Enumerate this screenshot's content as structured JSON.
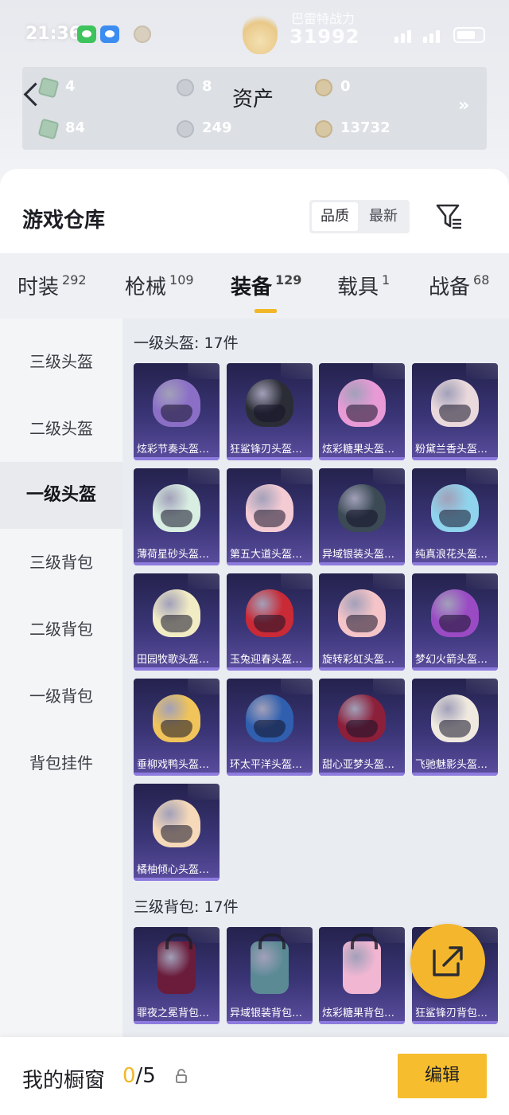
{
  "status_bar": {
    "time": "21:36",
    "battery": "41",
    "combat_power_label": "巴雷特战力",
    "combat_power_value": "31992"
  },
  "assets": {
    "title": "资产",
    "items": [
      {
        "value": "4",
        "icon": "silver-note-icon"
      },
      {
        "value": "8",
        "icon": "silver-coin-icon"
      },
      {
        "value": "0",
        "icon": "gold-coin-icon"
      },
      {
        "value": "84",
        "icon": "green-note-icon"
      },
      {
        "value": "249",
        "icon": "gray-coin-icon"
      },
      {
        "value": "13732",
        "icon": "bronze-coin-icon"
      }
    ],
    "more": "»"
  },
  "warehouse": {
    "title": "游戏仓库",
    "sort": {
      "quality": "品质",
      "latest": "最新"
    }
  },
  "tabs": [
    {
      "label": "时装",
      "count": "292"
    },
    {
      "label": "枪械",
      "count": "109"
    },
    {
      "label": "装备",
      "count": "129"
    },
    {
      "label": "载具",
      "count": "1"
    },
    {
      "label": "战备",
      "count": "68"
    }
  ],
  "sidebar": {
    "items": [
      {
        "label": "三级头盔"
      },
      {
        "label": "二级头盔"
      },
      {
        "label": "一级头盔"
      },
      {
        "label": "三级背包"
      },
      {
        "label": "二级背包"
      },
      {
        "label": "一级背包"
      },
      {
        "label": "背包挂件"
      }
    ]
  },
  "sections": [
    {
      "title": "一级头盔: 17件",
      "items": [
        {
          "name": "炫彩节奏头盔（一级）",
          "color": "#8b6fc7"
        },
        {
          "name": "狂鲨锋刃头盔（一级）",
          "color": "#2b2d36"
        },
        {
          "name": "炫彩糖果头盔（一级）",
          "color": "#e79ad6"
        },
        {
          "name": "粉黛兰香头盔（一级）",
          "color": "#ead9dc"
        },
        {
          "name": "薄荷星砂头盔（一级）",
          "color": "#d9eee2"
        },
        {
          "name": "第五大道头盔（一级）",
          "color": "#f4cbd3"
        },
        {
          "name": "异域银装头盔（一级）",
          "color": "#3b4a55"
        },
        {
          "name": "纯真浪花头盔（一级）",
          "color": "#8fd3ec"
        },
        {
          "name": "田园牧歌头盔（一级）",
          "color": "#f2ecc5"
        },
        {
          "name": "玉兔迎春头盔（一级）",
          "color": "#c92a36"
        },
        {
          "name": "旋转彩虹头盔（一级）",
          "color": "#f5c4c8"
        },
        {
          "name": "梦幻火箭头盔（一级）",
          "color": "#9a4bc4"
        },
        {
          "name": "垂柳戏鸭头盔（一级）",
          "color": "#f0c45a"
        },
        {
          "name": "环太平洋头盔（一级）",
          "color": "#2f5fae"
        },
        {
          "name": "甜心亚梦头盔（一级）",
          "color": "#8c1f3a"
        },
        {
          "name": "飞驰魅影头盔（一级）",
          "color": "#efe9df"
        },
        {
          "name": "橘柚倾心头盔（一级）",
          "color": "#f6d9b8"
        }
      ]
    },
    {
      "title": "三级背包: 17件",
      "items": [
        {
          "name": "罪夜之冕背包（三级）",
          "color": "#6a1c3a"
        },
        {
          "name": "异域银装背包（三级）",
          "color": "#5b8a95"
        },
        {
          "name": "炫彩糖果背包（三级）",
          "color": "#f1b6d2"
        },
        {
          "name": "狂鲨锋刃背包（三级）",
          "color": "#2f3340"
        }
      ]
    }
  ],
  "showcase": {
    "label": "我的橱窗",
    "current": "0",
    "total": "/5",
    "edit": "编辑"
  },
  "colors": {
    "accent": "#f0b728",
    "card_bg": "#3a3576",
    "card_bar": "#8e7bde"
  }
}
